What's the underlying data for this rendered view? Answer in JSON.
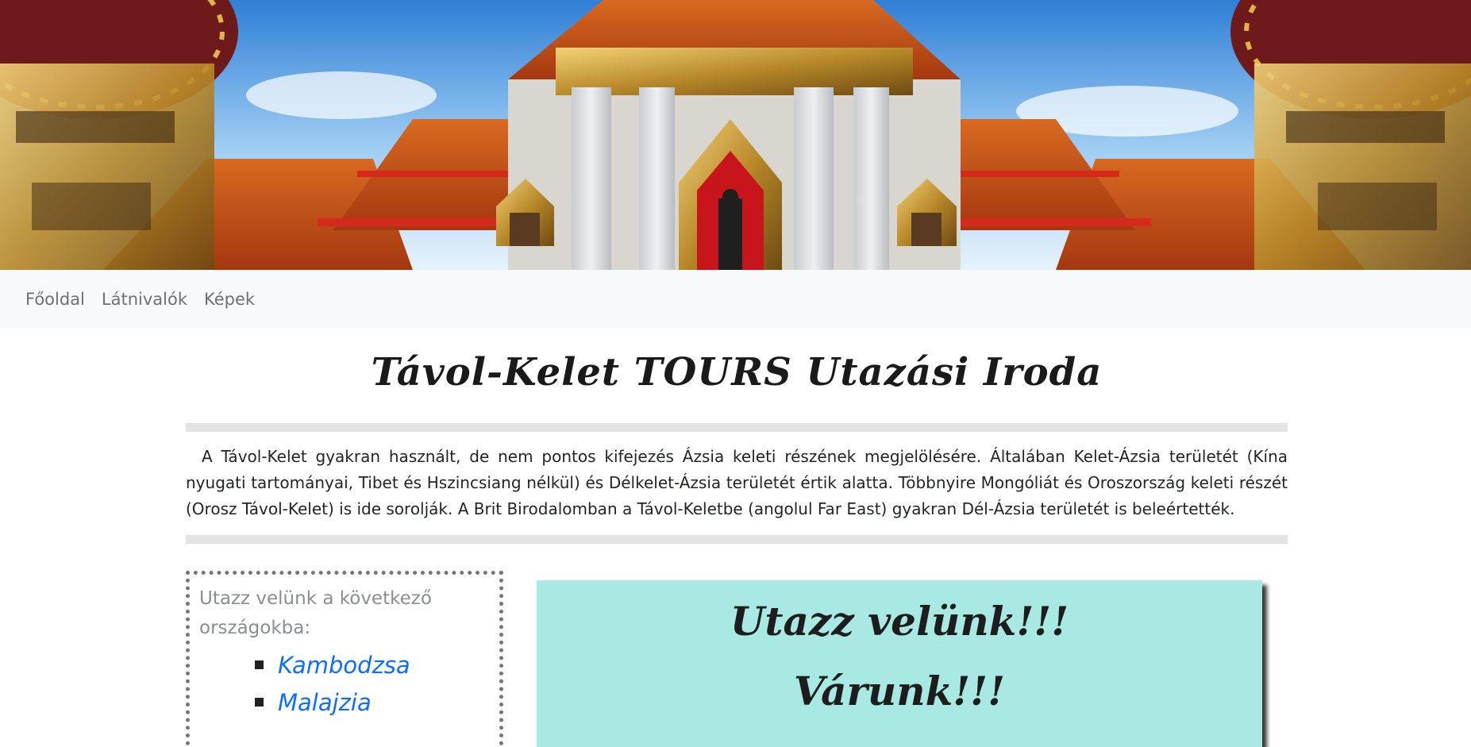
{
  "nav": {
    "items": [
      {
        "label": "Főoldal"
      },
      {
        "label": "Látnivalók"
      },
      {
        "label": "Képek"
      }
    ]
  },
  "main": {
    "title": "Távol-Kelet TOURS Utazási Iroda",
    "intro": "A Távol-Kelet gyakran használt, de nem pontos kifejezés Ázsia keleti részének megjelölésére. Általában Kelet-Ázsia területét (Kína nyugati tartományai, Tibet és Hszincsiang nélkül) és Délkelet-Ázsia területét értik alatta. Többnyire Mongóliát és Oroszország keleti részét (Orosz Távol-Kelet) is ide sorolják. A Brit Birodalomban a Távol-Keletbe (angolul Far East) gyakran Dél-Ázsia területét is beleértették."
  },
  "countries": {
    "intro": "Utazz velünk a következő országokba:",
    "items": [
      {
        "label": "Kambodzsa"
      },
      {
        "label": "Malajzia"
      }
    ]
  },
  "promo": {
    "line1": "Utazz velünk!!!",
    "line2": "Várunk!!!"
  },
  "colors": {
    "navbar_bg": "#f8f9fa",
    "link": "#0d6efd",
    "promo_bg": "#a8e9e3",
    "divider": "#e3e3e3"
  }
}
